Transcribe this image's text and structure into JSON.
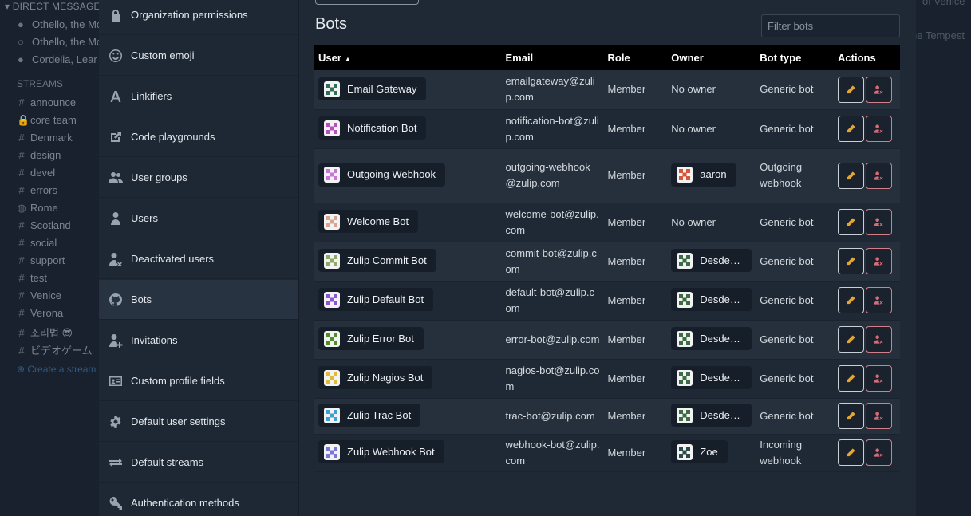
{
  "left_sidebar": {
    "dm_header": "DIRECT MESSAGES",
    "dms": [
      "Othello, the Moor of Venice",
      "Othello, the Moor",
      "Cordelia, Lear"
    ],
    "streams_header": "STREAMS",
    "streams": [
      {
        "name": "announce",
        "icon": "hash-icon"
      },
      {
        "name": "core team",
        "icon": "lock-icon"
      },
      {
        "name": "Denmark",
        "icon": "hash-icon"
      },
      {
        "name": "design",
        "icon": "hash-icon"
      },
      {
        "name": "devel",
        "icon": "hash-icon"
      },
      {
        "name": "errors",
        "icon": "hash-icon"
      },
      {
        "name": "Rome",
        "icon": "globe-icon"
      },
      {
        "name": "Scotland",
        "icon": "hash-icon"
      },
      {
        "name": "social",
        "icon": "hash-icon"
      },
      {
        "name": "support",
        "icon": "hash-icon"
      },
      {
        "name": "test",
        "icon": "hash-icon"
      },
      {
        "name": "Venice",
        "icon": "hash-icon"
      },
      {
        "name": "Verona",
        "icon": "hash-icon"
      },
      {
        "name": "조리법 😎",
        "icon": "hash-icon"
      },
      {
        "name": "ビデオゲーム",
        "icon": "hash-icon"
      }
    ],
    "create_stream": "Create a stream"
  },
  "right_bg": {
    "text1": "of Venice",
    "text2": "he Tempest"
  },
  "settings_nav": [
    {
      "label": "Organization permissions",
      "icon": "lock-icon"
    },
    {
      "label": "Custom emoji",
      "icon": "smile-icon"
    },
    {
      "label": "Linkifiers",
      "icon": "font-icon"
    },
    {
      "label": "Code playgrounds",
      "icon": "external-link-icon"
    },
    {
      "label": "User groups",
      "icon": "users-icon"
    },
    {
      "label": "Users",
      "icon": "user-icon"
    },
    {
      "label": "Deactivated users",
      "icon": "user-times-icon"
    },
    {
      "label": "Bots",
      "icon": "github-icon",
      "active": true
    },
    {
      "label": "Invitations",
      "icon": "user-plus-icon"
    },
    {
      "label": "Custom profile fields",
      "icon": "id-card-icon"
    },
    {
      "label": "Default user settings",
      "icon": "gear-icon"
    },
    {
      "label": "Default streams",
      "icon": "exchange-icon"
    },
    {
      "label": "Authentication methods",
      "icon": "key-icon"
    }
  ],
  "main": {
    "title": "Bots",
    "filter_placeholder": "Filter bots",
    "columns": {
      "user": "User",
      "email": "Email",
      "role": "Role",
      "owner": "Owner",
      "bot_type": "Bot type",
      "actions": "Actions"
    },
    "sort_icon": "caret-up-icon",
    "bots": [
      {
        "name": "Email Gateway",
        "email": "emailgateway@zulip.com",
        "role": "Member",
        "owner": "No owner",
        "owner_avatar": false,
        "bot_type": "Generic bot",
        "avatar_color": "#2f6f57"
      },
      {
        "name": "Notification Bot",
        "email": "notification-bot@zulip.com",
        "role": "Member",
        "owner": "No owner",
        "owner_avatar": false,
        "bot_type": "Generic bot",
        "avatar_color": "#b54fc0"
      },
      {
        "name": "Outgoing Webhook",
        "email": "outgoing-webhook@zulip.com",
        "role": "Member",
        "owner": "aaron",
        "owner_avatar": true,
        "owner_color": "#d6553b",
        "bot_type": "Outgoing webhook",
        "avatar_color": "#c778d4"
      },
      {
        "name": "Welcome Bot",
        "email": "welcome-bot@zulip.com",
        "role": "Member",
        "owner": "No owner",
        "owner_avatar": false,
        "bot_type": "Generic bot",
        "avatar_color": "#d8a48f"
      },
      {
        "name": "Zulip Commit Bot",
        "email": "commit-bot@zulip.com",
        "role": "Member",
        "owner": "Desdemona",
        "owner_avatar": true,
        "owner_color": "#3d6b45",
        "bot_type": "Generic bot",
        "avatar_color": "#8fa867"
      },
      {
        "name": "Zulip Default Bot",
        "email": "default-bot@zulip.com",
        "role": "Member",
        "owner": "Desdemona",
        "owner_avatar": true,
        "owner_color": "#3d6b45",
        "bot_type": "Generic bot",
        "avatar_color": "#8b55d6"
      },
      {
        "name": "Zulip Error Bot",
        "email": "error-bot@zulip.com",
        "role": "Member",
        "owner": "Desdemona",
        "owner_avatar": true,
        "owner_color": "#3d6b45",
        "bot_type": "Generic bot",
        "avatar_color": "#4f8c2a"
      },
      {
        "name": "Zulip Nagios Bot",
        "email": "nagios-bot@zulip.com",
        "role": "Member",
        "owner": "Desdemona",
        "owner_avatar": true,
        "owner_color": "#3d6b45",
        "bot_type": "Generic bot",
        "avatar_color": "#e0b93a"
      },
      {
        "name": "Zulip Trac Bot",
        "email": "trac-bot@zulip.com",
        "role": "Member",
        "owner": "Desdemona",
        "owner_avatar": true,
        "owner_color": "#3d6b45",
        "bot_type": "Generic bot",
        "avatar_color": "#3aa0d6"
      },
      {
        "name": "Zulip Webhook Bot",
        "email": "webhook-bot@zulip.com",
        "role": "Member",
        "owner": "Zoe",
        "owner_avatar": true,
        "owner_color": "#2d4a4a",
        "bot_type": "Incoming webhook",
        "avatar_color": "#7b76d6"
      }
    ]
  },
  "colors": {
    "edit_icon": "#e3a633",
    "deactivate_icon": "#d76b78"
  }
}
